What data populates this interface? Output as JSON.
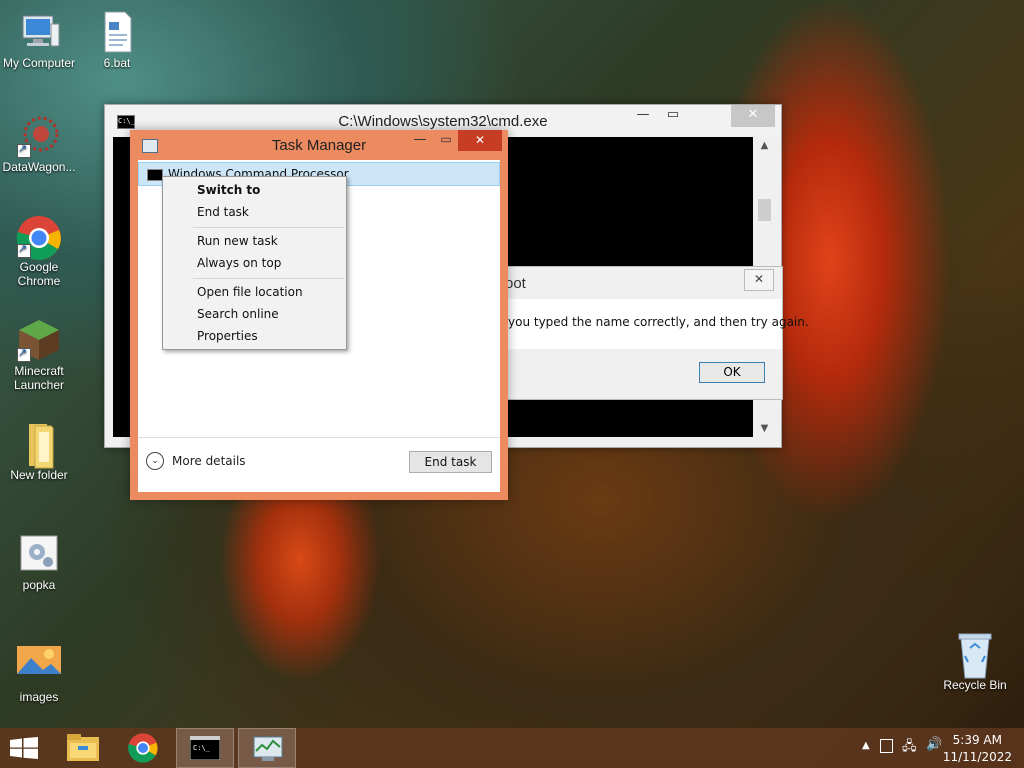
{
  "desktop": {
    "icons": [
      {
        "label": "My Computer",
        "icon": "computer-icon"
      },
      {
        "label": "6.bat",
        "icon": "batch-file-icon"
      },
      {
        "label": "DataWagon...",
        "icon": "datawagon-icon"
      },
      {
        "label": "Google Chrome",
        "icon": "chrome-icon"
      },
      {
        "label": "Minecraft Launcher",
        "icon": "minecraft-icon"
      },
      {
        "label": "New folder",
        "icon": "folder-icon"
      },
      {
        "label": "popka",
        "icon": "settings-file-icon"
      },
      {
        "label": "images",
        "icon": "image-file-icon"
      },
      {
        "label": "Recycle Bin",
        "icon": "recycle-bin-icon"
      }
    ]
  },
  "cmd_window": {
    "title": "C:\\Windows\\system32\\cmd.exe",
    "icon_text": "C:\\_"
  },
  "error_dialog": {
    "title_fragment": "oot",
    "message_fragment": "you typed the name correctly, and then try again.",
    "ok_label": "OK"
  },
  "task_manager": {
    "title": "Task Manager",
    "process_row": "Windows Command Processor",
    "more_details": "More details",
    "end_task": "End task"
  },
  "context_menu": {
    "items": [
      "Switch to",
      "End task",
      "Run new task",
      "Always on top",
      "Open file location",
      "Search online",
      "Properties"
    ]
  },
  "taskbar": {
    "items": [
      "start-icon",
      "file-explorer-icon",
      "chrome-icon",
      "cmd-icon",
      "task-manager-icon"
    ],
    "clock_time": "5:39 AM",
    "clock_date": "11/11/2022"
  },
  "colors": {
    "task_manager_frame": "#ec8a60",
    "close_button": "#c73c25",
    "selection": "#cde6f7",
    "taskbar": "#5f371e"
  }
}
